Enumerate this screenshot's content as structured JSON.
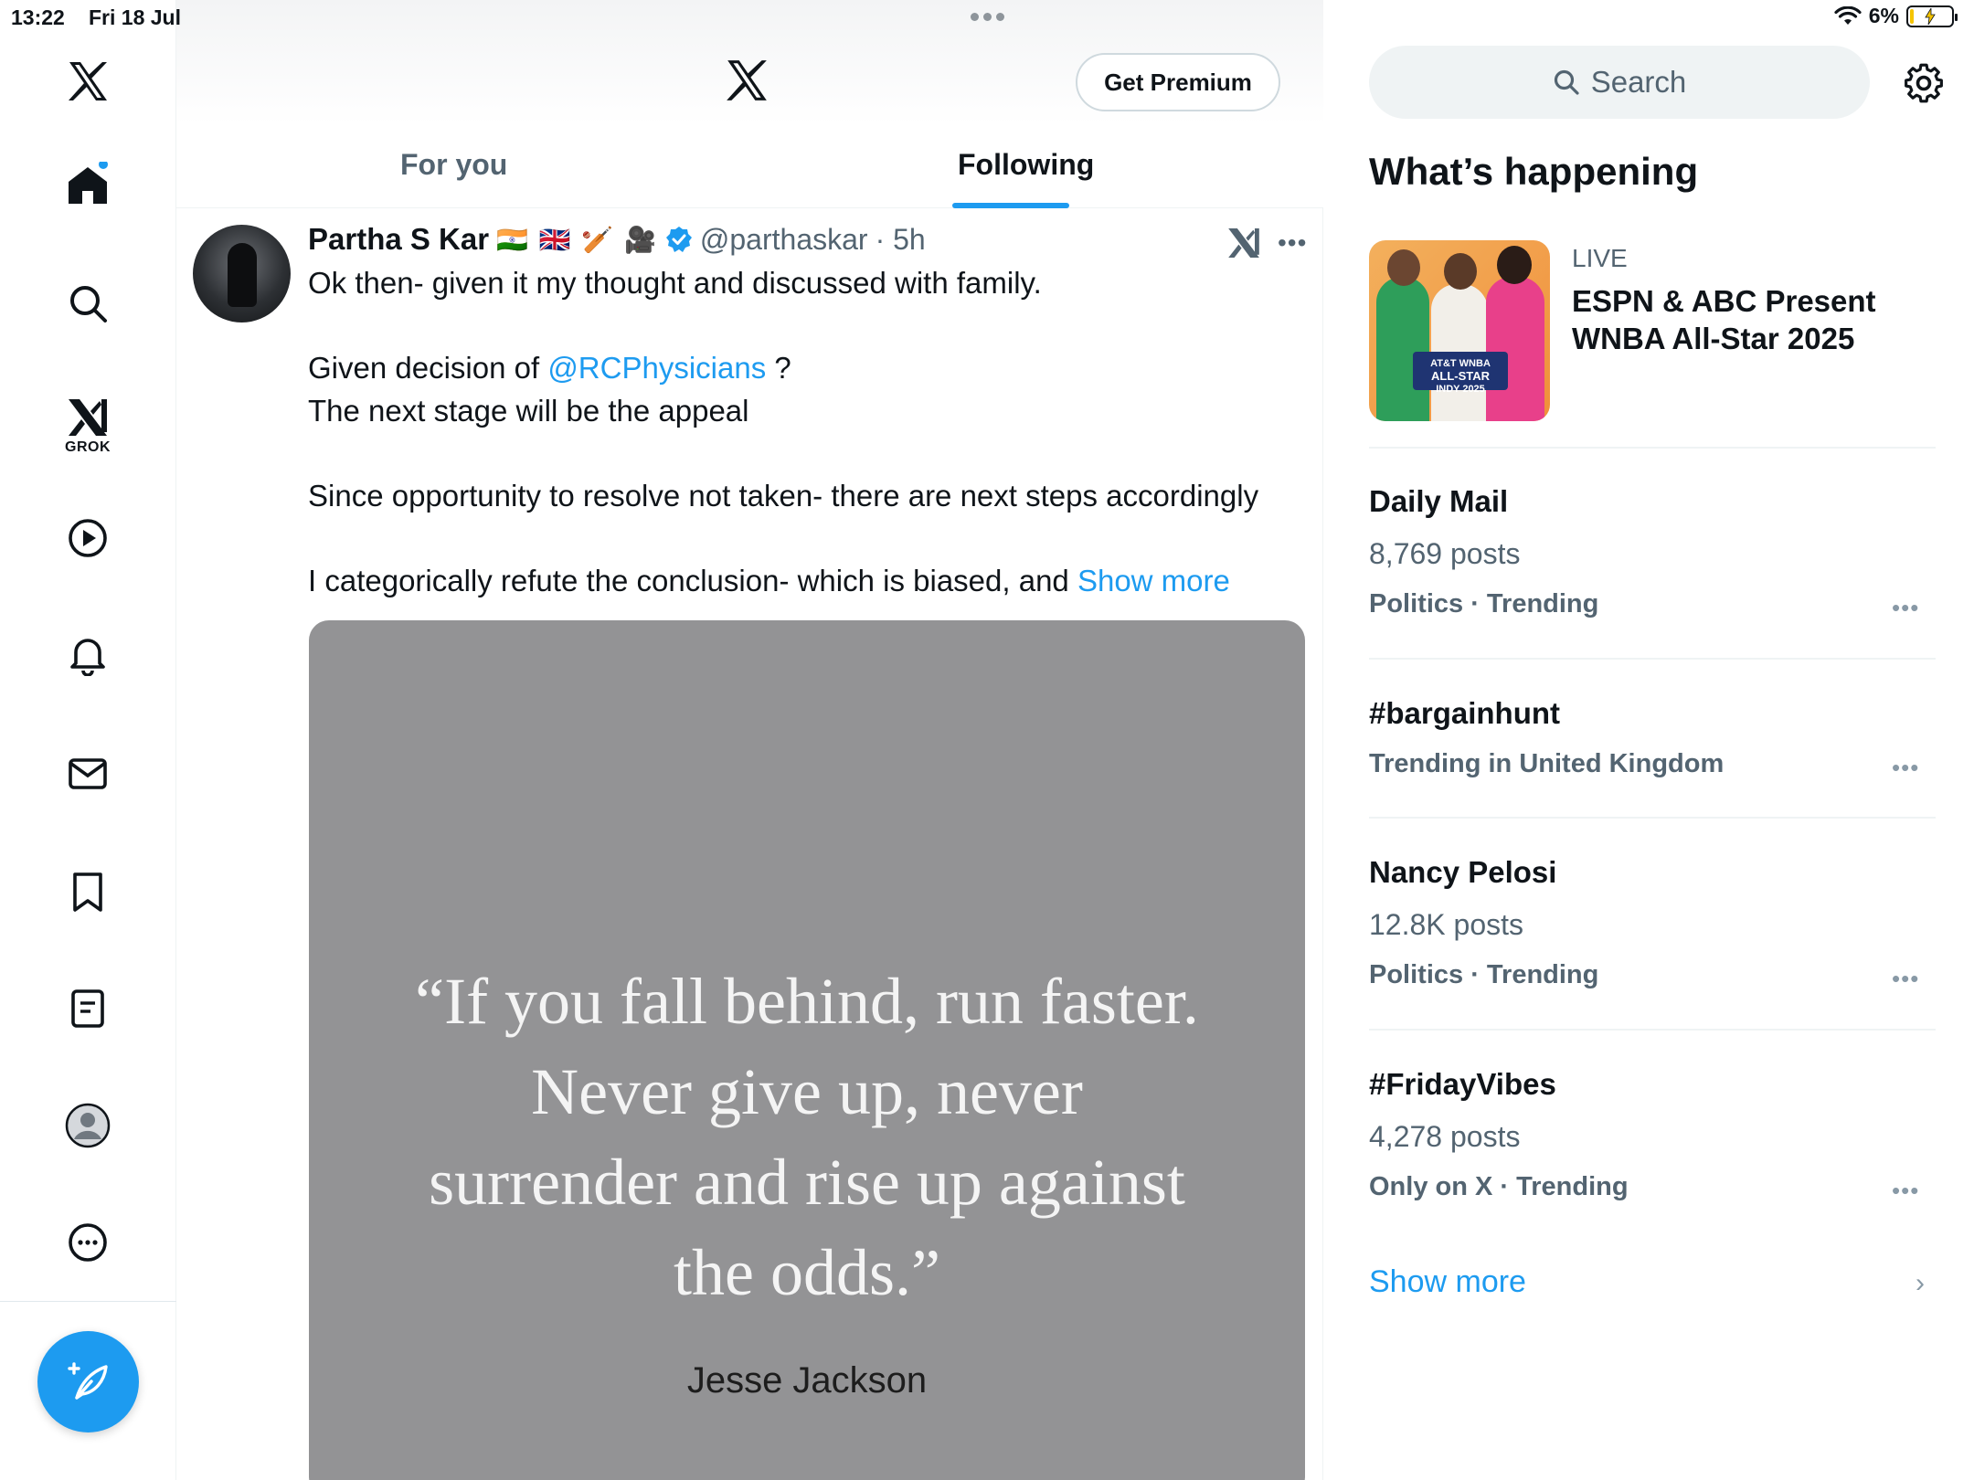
{
  "status_bar": {
    "time": "13:22",
    "date": "Fri 18 Jul",
    "battery": "6%"
  },
  "left_nav": {
    "logo": "x-logo-icon",
    "items": [
      {
        "name": "home",
        "icon": "home-icon",
        "has_badge": true
      },
      {
        "name": "explore",
        "icon": "search-icon"
      },
      {
        "name": "grok",
        "icon": "grok-icon",
        "label": "GROK"
      },
      {
        "name": "video",
        "icon": "play-icon"
      },
      {
        "name": "notifications",
        "icon": "bell-icon"
      },
      {
        "name": "messages",
        "icon": "mail-icon"
      },
      {
        "name": "bookmarks",
        "icon": "bookmark-icon"
      },
      {
        "name": "lists",
        "icon": "list-icon"
      },
      {
        "name": "profile",
        "icon": "profile-icon"
      },
      {
        "name": "more",
        "icon": "more-circle-icon"
      }
    ],
    "compose_icon": "compose-icon",
    "accent": "#1d9bf0"
  },
  "header": {
    "premium_label": "Get Premium",
    "tabs": [
      {
        "label": "For you",
        "active": false
      },
      {
        "label": "Following",
        "active": true
      }
    ]
  },
  "post": {
    "name": "Partha S Kar",
    "emojis": "🇮🇳 🇬🇧 🏏 🎥",
    "handle": "@parthaskar",
    "time": "· 5h",
    "line1": "Ok then- given it my thought and discussed with family.",
    "line2_pre": "Given decision of ",
    "line2_link": "@RCPhysicians",
    "line2_post": " ?",
    "line3": "The next stage will be the appeal",
    "line4": "Since opportunity to resolve not taken- there are next steps accordingly",
    "line5": "I categorically refute the conclusion- which is biased, and ",
    "show_more": "Show more",
    "image": {
      "quote_lines": [
        "“If you fall behind, run faster.",
        "Never give up, never",
        "surrender and rise up against",
        "the odds.”"
      ],
      "author": "Jesse Jackson",
      "background": "#939395"
    }
  },
  "sidebar": {
    "search_placeholder": "Search",
    "section_title": "What’s happening",
    "live": {
      "label": "LIVE",
      "title": "ESPN & ABC Present WNBA All-Star 2025",
      "thumb_badge_lines": [
        "AT&T WNBA",
        "ALL-STAR",
        "INDY 2025"
      ]
    },
    "trends": [
      {
        "title": "Daily Mail",
        "count": "8,769 posts",
        "category": "Politics · Trending"
      },
      {
        "title": "#bargainhunt",
        "count": "",
        "category": "Trending in United Kingdom"
      },
      {
        "title": "Nancy Pelosi",
        "count": "12.8K posts",
        "category": "Politics · Trending"
      },
      {
        "title": "#FridayVibes",
        "count": "4,278 posts",
        "category": "Only on X · Trending"
      }
    ],
    "show_more": "Show more"
  }
}
